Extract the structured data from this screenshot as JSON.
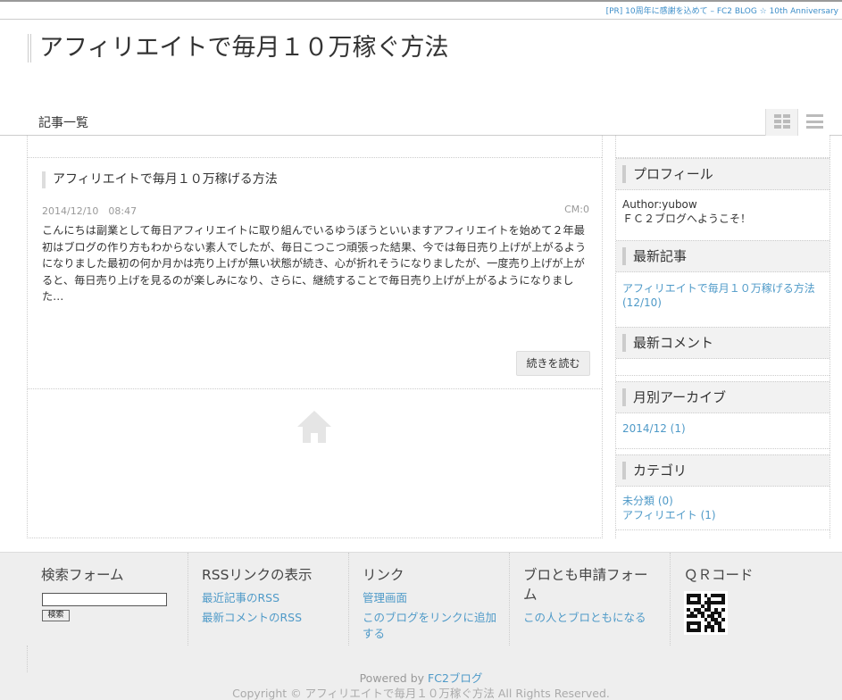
{
  "pr": {
    "text": "[PR] 10周年に感謝を込めて – FC2 BLOG ☆ 10th Anniversary"
  },
  "header": {
    "title": "アフィリエイトで毎月１０万稼ぐ方法"
  },
  "nav": {
    "label": "記事一覧"
  },
  "entry": {
    "title": "アフィリエイトで毎月１０万稼げる方法",
    "date": "2014/12/10　08:47",
    "comments": "CM:0",
    "body": "こんにちは副業として毎日アフィリエイトに取り組んでいるゆうぼうといいますアフィリエイトを始めて２年最初はブログの作り方もわからない素人でしたが、毎日こつこつ頑張った結果、今では毎日売り上げが上がるようになりました最初の何か月かは売り上げが無い状態が続き、心が折れそうになりましたが、一度売り上げが上がると、毎日売り上げを見るのが楽しみになり、さらに、継続することで毎日売り上げが上がるようになりました…",
    "read_more": "続きを読む"
  },
  "sidebar": {
    "profile": {
      "heading": "プロフィール",
      "author": "Author:yubow",
      "message": "ＦＣ２ブログへようこそ！"
    },
    "recent_posts": {
      "heading": "最新記事",
      "items": [
        "アフィリエイトで毎月１０万稼げる方法 (12/10)"
      ]
    },
    "recent_comments": {
      "heading": "最新コメント"
    },
    "archives": {
      "heading": "月別アーカイブ",
      "items": [
        "2014/12 (1)"
      ]
    },
    "categories": {
      "heading": "カテゴリ",
      "items": [
        "未分類 (0)",
        "アフィリエイト (1)"
      ]
    }
  },
  "footer": {
    "search": {
      "heading": "検索フォーム",
      "input_value": "",
      "button": "検索"
    },
    "rss": {
      "heading": "RSSリンクの表示",
      "links": [
        "最近記事のRSS",
        "最新コメントのRSS"
      ]
    },
    "links": {
      "heading": "リンク",
      "links": [
        "管理画面",
        "このブログをリンクに追加する"
      ]
    },
    "friend": {
      "heading": "ブロとも申請フォーム",
      "links": [
        "この人とブロともになる"
      ]
    },
    "qr": {
      "heading": "ＱＲコード"
    },
    "powered_prefix": "Powered by ",
    "powered_link": "FC2ブログ",
    "copyright": "Copyright © アフィリエイトで毎月１０万稼ぐ方法 All Rights Reserved."
  }
}
